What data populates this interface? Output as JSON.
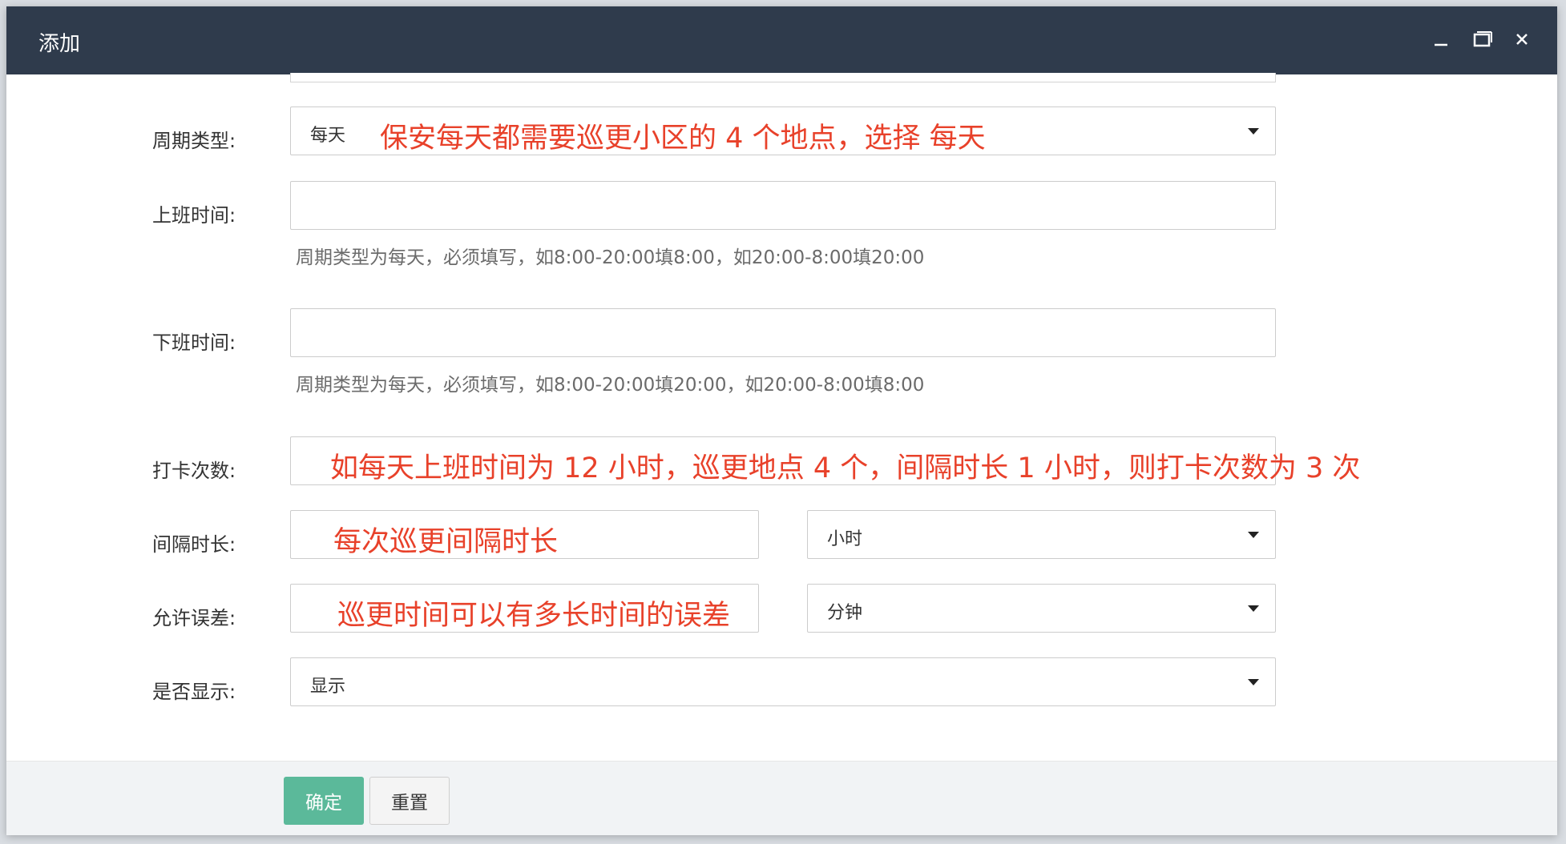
{
  "dialog": {
    "title": "添加",
    "window_buttons": [
      "minimize-icon",
      "maximize-icon",
      "close-icon"
    ]
  },
  "form": {
    "cycle_type": {
      "label": "周期类型:",
      "value": "每天",
      "note": "保安每天都需要巡更小区的 4 个地点，选择 每天"
    },
    "start_time": {
      "label": "上班时间:",
      "value": "",
      "hint": "周期类型为每天，必须填写，如8:00-20:00填8:00，如20:00-8:00填20:00"
    },
    "end_time": {
      "label": "下班时间:",
      "value": "",
      "hint": "周期类型为每天，必须填写，如8:00-20:00填20:00，如20:00-8:00填8:00"
    },
    "punch_count": {
      "label": "打卡次数:",
      "value": "",
      "note": "如每天上班时间为 12 小时，巡更地点 4 个，间隔时长 1 小时，则打卡次数为 3 次"
    },
    "interval": {
      "label": "间隔时长:",
      "value": "",
      "note": "每次巡更间隔时长",
      "unit": "小时"
    },
    "tolerance": {
      "label": "允许误差:",
      "value": "",
      "note": "巡更时间可以有多长时间的误差",
      "unit": "分钟"
    },
    "display": {
      "label": "是否显示:",
      "value": "显示"
    }
  },
  "footer": {
    "confirm_label": "确定",
    "reset_label": "重置"
  },
  "colors": {
    "titlebar": "#2f3b4c",
    "confirm": "#5bb99a",
    "annotation": "#e8412a"
  }
}
